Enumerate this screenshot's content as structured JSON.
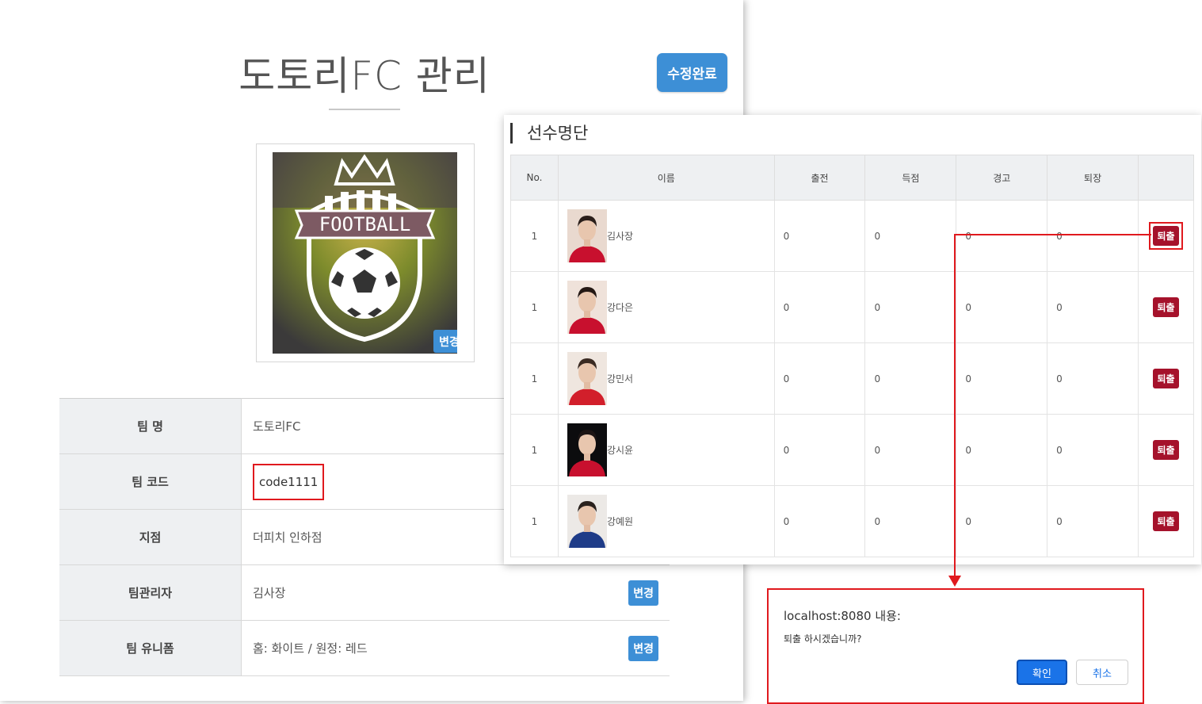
{
  "page": {
    "title": "도토리FC 관리",
    "done_button": "수정완료",
    "logo_change": "변경",
    "logo_text": "FOOTBALL"
  },
  "team_info": {
    "rows": [
      {
        "label": "팀 명",
        "value": "도토리FC"
      },
      {
        "label": "팀 코드",
        "value": "code1111"
      },
      {
        "label": "지점",
        "value": "더피치 인하점"
      },
      {
        "label": "팀관리자",
        "value": "김사장",
        "button": "변경"
      },
      {
        "label": "팀 유니폼",
        "value": "홈: 화이트 / 원정: 레드",
        "button": "변경"
      }
    ]
  },
  "roster": {
    "title": "선수명단",
    "headers": [
      "No.",
      "이름",
      "출전",
      "득점",
      "경고",
      "퇴장",
      ""
    ],
    "players": [
      {
        "no": "1",
        "name": "김사장",
        "apps": "0",
        "goals": "0",
        "warnings": "0",
        "redcards": "0",
        "action": "퇴출"
      },
      {
        "no": "1",
        "name": "강다은",
        "apps": "0",
        "goals": "0",
        "warnings": "0",
        "redcards": "0",
        "action": "퇴출"
      },
      {
        "no": "1",
        "name": "강민서",
        "apps": "0",
        "goals": "0",
        "warnings": "0",
        "redcards": "0",
        "action": "퇴출"
      },
      {
        "no": "1",
        "name": "강시윤",
        "apps": "0",
        "goals": "0",
        "warnings": "0",
        "redcards": "0",
        "action": "퇴출"
      },
      {
        "no": "1",
        "name": "강예원",
        "apps": "0",
        "goals": "0",
        "warnings": "0",
        "redcards": "0",
        "action": "퇴출"
      }
    ]
  },
  "dialog": {
    "title": "localhost:8080 내용:",
    "message": "퇴출 하시겠습니까?",
    "ok": "확인",
    "cancel": "취소"
  },
  "colors": {
    "accent_blue": "#3d8fd6",
    "kick_red": "#a5122b",
    "highlight_red": "#e0191e",
    "dialog_ok": "#1a73e8"
  }
}
